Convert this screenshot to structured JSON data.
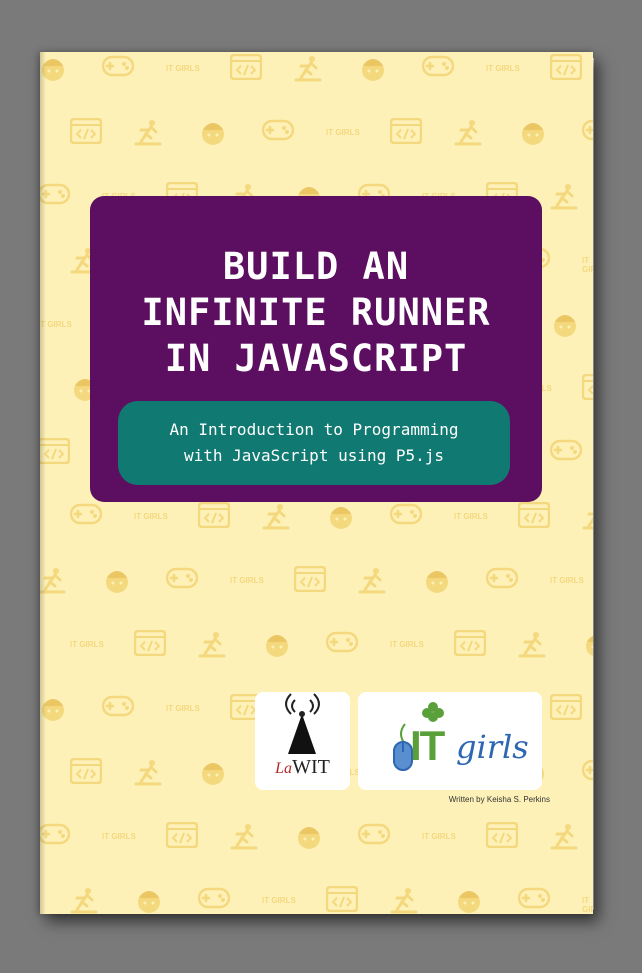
{
  "cover": {
    "background_color": "#fdf1b8",
    "title_lines": [
      "BUILD AN",
      "INFINITE RUNNER",
      "IN JAVASCRIPT"
    ],
    "subtitle_lines": [
      "An Introduction to Programming",
      "with JavaScript using P5.js"
    ],
    "title_panel_color": "#5c0f60",
    "subtitle_pill_color": "#107a72",
    "pattern_icons": [
      "girl-face-icon",
      "code-window-icon",
      "gamepad-icon",
      "runner-icon",
      "it-girls-text"
    ],
    "pattern_text": "IT GIRLS"
  },
  "logos": {
    "lawit": {
      "prefix": "La",
      "name": "WIT"
    },
    "itgirls": {
      "it": "IT",
      "girls": "girls"
    }
  },
  "author": "Written by Keisha S. Perkins"
}
